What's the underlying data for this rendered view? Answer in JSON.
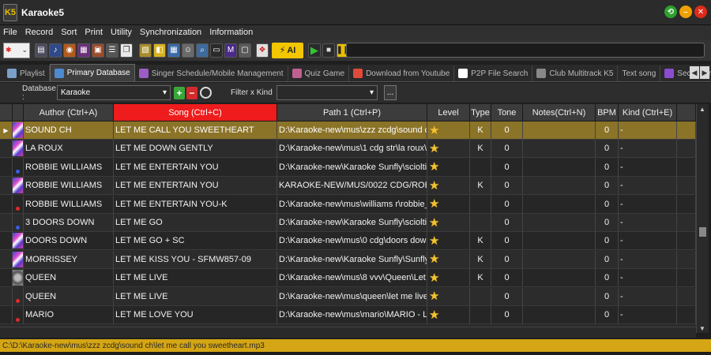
{
  "window": {
    "title": "Karaoke5",
    "logo": "K5"
  },
  "menu": [
    "File",
    "Record",
    "Sort",
    "Print",
    "Utility",
    "Synchronization",
    "Information"
  ],
  "toolbar": {
    "ai_label": "AI"
  },
  "tabs": [
    {
      "label": "Playlist",
      "icon": "folder-icon",
      "color": "#7aa0c8"
    },
    {
      "label": "Primary Database",
      "icon": "database-icon",
      "color": "#4d8ad0",
      "active": true
    },
    {
      "label": "Singer Schedule/Mobile Management",
      "icon": "mobile-icon",
      "color": "#9b5cc6"
    },
    {
      "label": "Quiz Game",
      "icon": "quiz-icon",
      "color": "#c06090"
    },
    {
      "label": "Download from Youtube",
      "icon": "youtube-icon",
      "color": "#e04a3a"
    },
    {
      "label": "P2P File Search",
      "icon": "p2p-icon",
      "color": "#ffffff"
    },
    {
      "label": "Club Multitrack K5",
      "icon": "multitrack-icon",
      "color": "#666666"
    },
    {
      "label": "Text song",
      "icon": "",
      "color": ""
    },
    {
      "label": "Secondary fields",
      "icon": "fields-icon",
      "color": "#8b4dd0"
    }
  ],
  "filter": {
    "database_label": "Database :",
    "database_value": "Karaoke",
    "filter_kind_label": "Filter x Kind",
    "filter_kind_value": "",
    "add": "+",
    "remove": "−",
    "more": "..."
  },
  "grid": {
    "columns": [
      "Author (Ctrl+A)",
      "Song (Ctrl+C)",
      "Path 1 (Ctrl+P)",
      "Level",
      "Type",
      "Tone",
      "Notes(Ctrl+N)",
      "BPM",
      "Kind (Ctrl+E)"
    ],
    "rows": [
      {
        "author": "SOUND CH",
        "song": "LET ME CALL YOU SWEETHEART",
        "path": "D:\\Karaoke-new\\mus\\zzz zcdg\\sound ch\\l",
        "type": "K",
        "tone": "0",
        "notes": "",
        "bpm": "0",
        "kind": "-",
        "thumb": "mosaic",
        "selected": true
      },
      {
        "author": "LA ROUX",
        "song": "LET ME DOWN GENTLY",
        "path": "D:\\Karaoke-new\\mus\\1 cdg str\\la roux\\Let",
        "type": "K",
        "tone": "0",
        "notes": "",
        "bpm": "0",
        "kind": "-",
        "thumb": "mosaic"
      },
      {
        "author": "ROBBIE WILLIAMS",
        "song": "LET ME ENTERTAIN YOU",
        "path": "D:\\Karaoke-new\\Karaoke Sunfly\\sciolti\\Ro",
        "type": "",
        "tone": "0",
        "notes": "",
        "bpm": "0",
        "kind": "-",
        "thumb": "dot-blue"
      },
      {
        "author": "ROBBIE WILLIAMS",
        "song": "LET ME ENTERTAIN YOU",
        "path": "KARAOKE-NEW/MUS/0022 CDG/ROBBI",
        "type": "K",
        "tone": "0",
        "notes": "",
        "bpm": "0",
        "kind": "-",
        "thumb": "mosaic"
      },
      {
        "author": "ROBBIE WILLIAMS",
        "song": "LET ME ENTERTAIN YOU-K",
        "path": "D:\\Karaoke-new\\mus\\williams r\\robbie_wil",
        "type": "",
        "tone": "0",
        "notes": "",
        "bpm": "0",
        "kind": "-",
        "thumb": "dot-red"
      },
      {
        "author": "3 DOORS DOWN",
        "song": "LET ME GO",
        "path": "D:\\Karaoke-new\\Karaoke Sunfly\\sciolti\\3 D",
        "type": "",
        "tone": "0",
        "notes": "",
        "bpm": "0",
        "kind": "-",
        "thumb": "dot-blue"
      },
      {
        "author": "DOORS DOWN",
        "song": "LET ME GO + SC",
        "path": "D:\\Karaoke-new\\mus\\0 cdg\\doors down\\L",
        "type": "K",
        "tone": "0",
        "notes": "",
        "bpm": "0",
        "kind": "-",
        "thumb": "mosaic"
      },
      {
        "author": "MORRISSEY",
        "song": "LET ME KISS YOU - SFMW857-09",
        "path": "D:\\Karaoke-new\\Karaoke Sunfly\\Sunfly M",
        "type": "K",
        "tone": "0",
        "notes": "",
        "bpm": "0",
        "kind": "-",
        "thumb": "mosaic"
      },
      {
        "author": "QUEEN",
        "song": "LET ME LIVE",
        "path": "D:\\Karaoke-new\\mus\\8 vvv\\Queen\\Let Me",
        "type": "K",
        "tone": "0",
        "notes": "",
        "bpm": "0",
        "kind": "-",
        "thumb": "film"
      },
      {
        "author": "QUEEN",
        "song": "LET ME LIVE",
        "path": "D:\\Karaoke-new\\mus\\queen\\let me live.mi",
        "type": "",
        "tone": "0",
        "notes": "",
        "bpm": "0",
        "kind": "-",
        "thumb": "dot-red"
      },
      {
        "author": "MARIO",
        "song": "LET ME LOVE YOU",
        "path": "D:\\Karaoke-new\\mus\\mario\\MARIO - LET",
        "type": "",
        "tone": "0",
        "notes": "",
        "bpm": "0",
        "kind": "-",
        "thumb": "dot-red"
      }
    ]
  },
  "status": {
    "path": "C:\\D:\\Karaoke-new\\mus\\zzz zcdg\\sound ch\\let me call you sweetheart.mp3"
  },
  "colors": {
    "accent": "#d4a514",
    "selected_row": "#8b7328",
    "sorted_header": "#ee1c1c",
    "star": "#f1c232"
  }
}
